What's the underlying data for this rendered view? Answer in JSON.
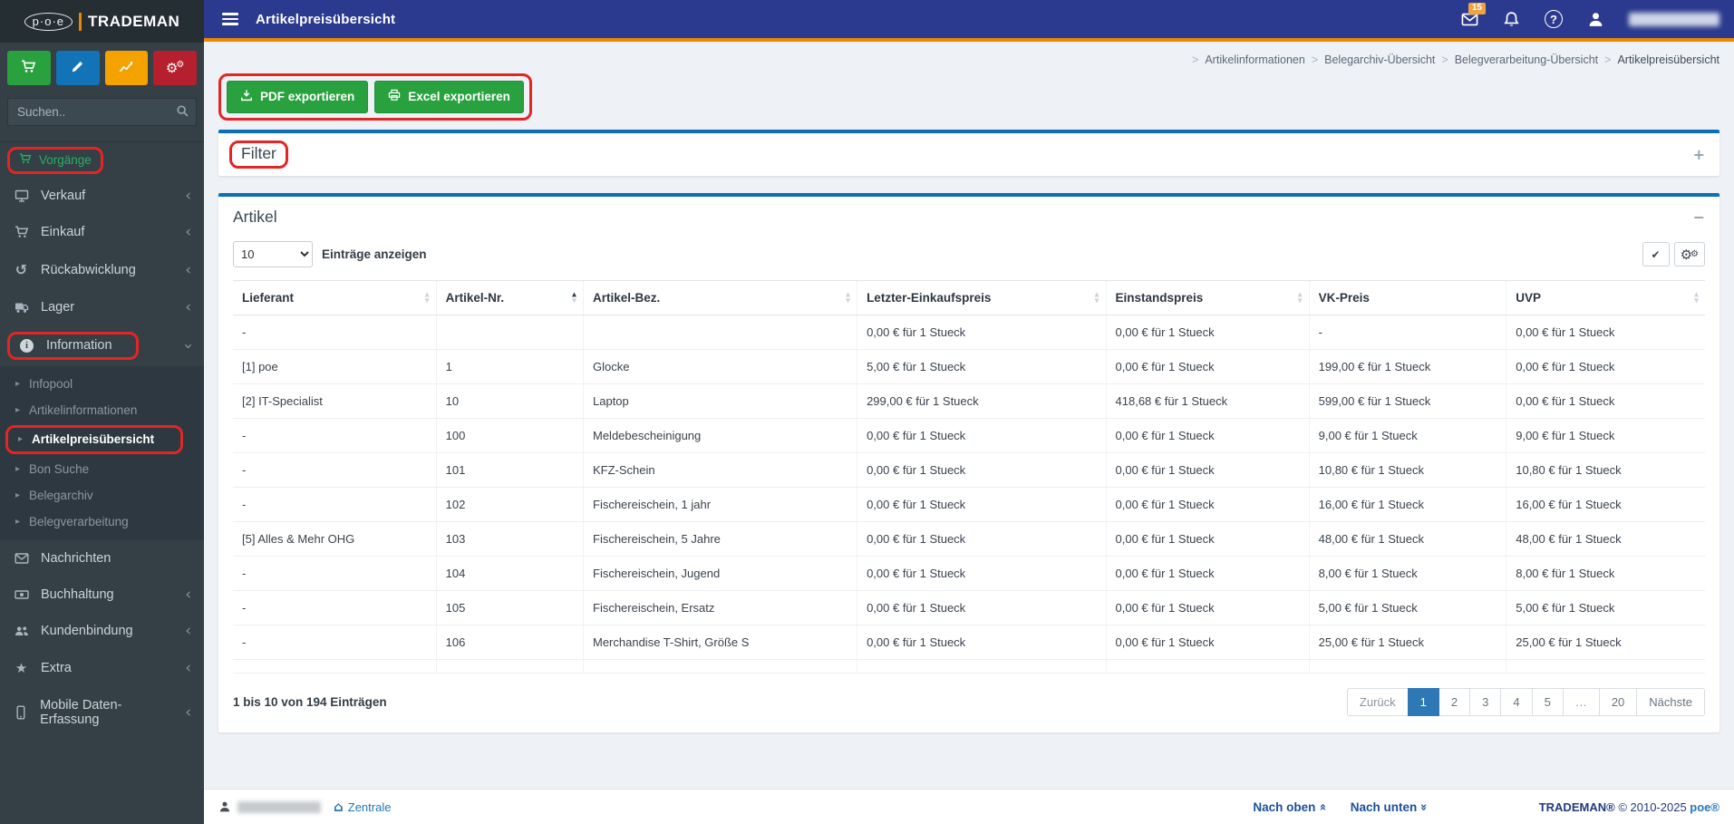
{
  "colors": {
    "topbar_blue": "#2b3a8e",
    "accent_orange": "#ee8600",
    "export_green": "#28a13e",
    "annotation_red": "#e32525",
    "panel_border_blue": "#0d6eb8",
    "active_page_blue": "#2e78b5",
    "sidebar_bg": "#343f46",
    "sidebar_section_green": "#27b161"
  },
  "icons": {
    "plus-icon": "+",
    "minus-icon": "−",
    "check-icon": "✔",
    "cogs-icon": "⚙",
    "home-icon": "⌂",
    "caret-right-icon": "▸",
    "sort-up-icon": "▴",
    "sort-down-icon": "▾",
    "chevron-left-icon": "‹",
    "chevron-double-icon": "«",
    "undo-icon": "↺",
    "star-icon": "★",
    "breadcrumb-separator": ">"
  },
  "sidebar": {
    "logo": {
      "poe": "p·o·e",
      "name": "TRADEMAN"
    },
    "quick_buttons": [
      {
        "name": "cart-quick-button",
        "icon": "cart",
        "color": "#28a13e"
      },
      {
        "name": "edit-quick-button",
        "icon": "pencil",
        "color": "#1273b6"
      },
      {
        "name": "stats-quick-button",
        "icon": "chart",
        "color": "#f3a200"
      },
      {
        "name": "settings-quick-button",
        "icon": "cogs",
        "color": "#b61f2e"
      }
    ],
    "search": {
      "placeholder": "Suchen.."
    },
    "section_label": "Vorgänge",
    "menu": [
      {
        "label": "Verkauf",
        "icon": "monitor",
        "chevron": true
      },
      {
        "label": "Einkauf",
        "icon": "cart",
        "chevron": true
      },
      {
        "label": "Rückabwicklung",
        "icon": "undo",
        "chevron": true
      },
      {
        "label": "Lager",
        "icon": "truck",
        "chevron": true
      },
      {
        "label": "Information",
        "icon": "info",
        "chevron": true,
        "expanded": true,
        "annotated": true,
        "children": [
          {
            "label": "Infopool"
          },
          {
            "label": "Artikelinformationen"
          },
          {
            "label": "Artikelpreisübersicht",
            "active": true,
            "annotated": true
          },
          {
            "label": "Bon Suche"
          },
          {
            "label": "Belegarchiv"
          },
          {
            "label": "Belegverarbeitung"
          }
        ]
      },
      {
        "label": "Nachrichten",
        "icon": "envelope"
      },
      {
        "label": "Buchhaltung",
        "icon": "money",
        "chevron": true
      },
      {
        "label": "Kundenbindung",
        "icon": "users",
        "chevron": true
      },
      {
        "label": "Extra",
        "icon": "star",
        "chevron": true
      },
      {
        "label": "Mobile Daten-Erfassung",
        "icon": "mobile",
        "chevron": true
      }
    ]
  },
  "topbar": {
    "title": "Artikelpreisübersicht",
    "mail_badge": "15"
  },
  "breadcrumb": {
    "items": [
      "Artikelinformationen",
      "Belegarchiv-Übersicht",
      "Belegverarbeitung-Übersicht",
      "Artikelpreisübersicht"
    ]
  },
  "toolbar": {
    "pdf_label": "PDF exportieren",
    "excel_label": "Excel exportieren"
  },
  "filter_panel": {
    "title": "Filter"
  },
  "table_panel": {
    "title": "Artikel",
    "page_size": "10",
    "entries_label": "Einträge anzeigen",
    "columns": [
      {
        "label": "Lieferant",
        "sort": "none"
      },
      {
        "label": "Artikel-Nr.",
        "sort": "asc"
      },
      {
        "label": "Artikel-Bez.",
        "sort": "none"
      },
      {
        "label": "Letzter-Einkaufspreis",
        "sort": "none"
      },
      {
        "label": "Einstandspreis",
        "sort": "none"
      },
      {
        "label": "VK-Preis",
        "sort": null
      },
      {
        "label": "UVP",
        "sort": "none"
      }
    ],
    "rows": [
      [
        "-",
        "",
        "",
        "0,00 € für 1 Stueck",
        "0,00 € für 1 Stueck",
        "-",
        "0,00 € für 1 Stueck"
      ],
      [
        "[1] poe",
        "1",
        "Glocke",
        "5,00 € für 1 Stueck",
        "0,00 € für 1 Stueck",
        "199,00 € für 1 Stueck",
        "0,00 € für 1 Stueck"
      ],
      [
        "[2] IT-Specialist",
        "10",
        "Laptop",
        "299,00 € für 1 Stueck",
        "418,68 € für 1 Stueck",
        "599,00 € für 1 Stueck",
        "0,00 € für 1 Stueck"
      ],
      [
        "-",
        "100",
        "Meldebescheinigung",
        "0,00 € für 1 Stueck",
        "0,00 € für 1 Stueck",
        "9,00 € für 1 Stueck",
        "9,00 € für 1 Stueck"
      ],
      [
        "-",
        "101",
        "KFZ-Schein",
        "0,00 € für 1 Stueck",
        "0,00 € für 1 Stueck",
        "10,80 € für 1 Stueck",
        "10,80 € für 1 Stueck"
      ],
      [
        "-",
        "102",
        "Fischereischein, 1 jahr",
        "0,00 € für 1 Stueck",
        "0,00 € für 1 Stueck",
        "16,00 € für 1 Stueck",
        "16,00 € für 1 Stueck"
      ],
      [
        "[5] Alles & Mehr OHG",
        "103",
        "Fischereischein, 5 Jahre",
        "0,00 € für 1 Stueck",
        "0,00 € für 1 Stueck",
        "48,00 € für 1 Stueck",
        "48,00 € für 1 Stueck"
      ],
      [
        "-",
        "104",
        "Fischereischein, Jugend",
        "0,00 € für 1 Stueck",
        "0,00 € für 1 Stueck",
        "8,00 € für 1 Stueck",
        "8,00 € für 1 Stueck"
      ],
      [
        "-",
        "105",
        "Fischereischein, Ersatz",
        "0,00 € für 1 Stueck",
        "0,00 € für 1 Stueck",
        "5,00 € für 1 Stueck",
        "5,00 € für 1 Stueck"
      ],
      [
        "-",
        "106",
        "Merchandise T-Shirt, Größe S",
        "0,00 € für 1 Stueck",
        "0,00 € für 1 Stueck",
        "25,00 € für 1 Stueck",
        "25,00 € für 1 Stueck"
      ]
    ],
    "info": "1 bis 10 von 194 Einträgen",
    "pagination": {
      "prev": "Zurück",
      "pages": [
        "1",
        "2",
        "3",
        "4",
        "5",
        "…",
        "20"
      ],
      "active": "1",
      "next": "Nächste"
    }
  },
  "footer": {
    "zentrale": "Zentrale",
    "nach_oben": "Nach oben",
    "nach_unten": "Nach unten",
    "brand": "TRADEMAN®",
    "copyright": "© 2010-2025",
    "owner": "poe®"
  }
}
